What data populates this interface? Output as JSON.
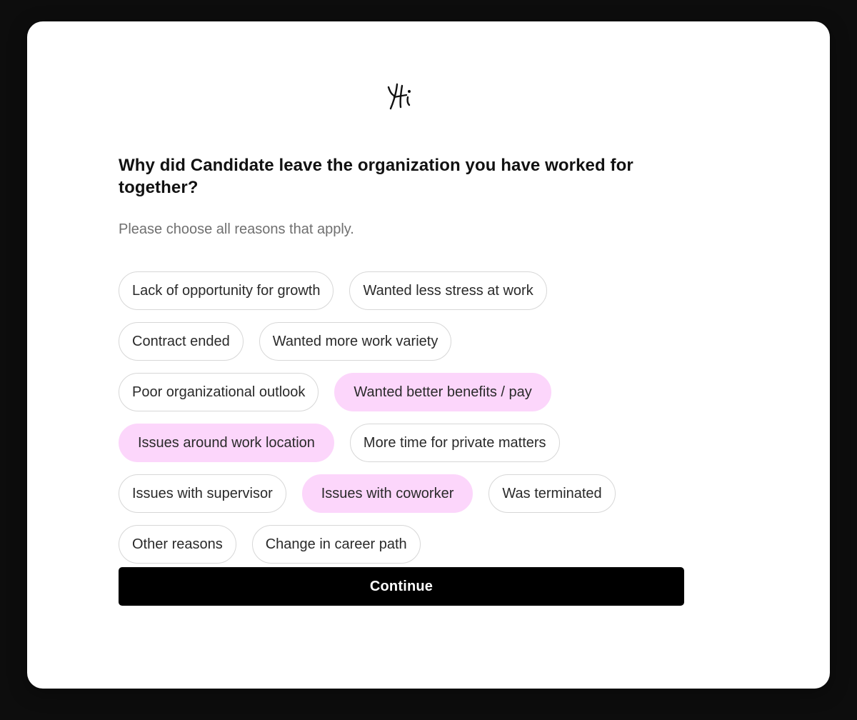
{
  "logo": {
    "icon": "yi-signature-logo"
  },
  "question": "Why did Candidate leave the organization you have worked for together?",
  "hint": "Please choose all reasons that apply.",
  "options": [
    {
      "label": "Lack of opportunity for growth",
      "selected": false
    },
    {
      "label": "Wanted less stress at work",
      "selected": false
    },
    {
      "label": "Contract ended",
      "selected": false
    },
    {
      "label": "Wanted more work variety",
      "selected": false
    },
    {
      "label": "Poor organizational outlook",
      "selected": false
    },
    {
      "label": "Wanted better benefits / pay",
      "selected": true
    },
    {
      "label": "Issues around work location",
      "selected": true
    },
    {
      "label": "More time for private matters",
      "selected": false
    },
    {
      "label": "Issues with supervisor",
      "selected": false
    },
    {
      "label": "Issues with coworker",
      "selected": true
    },
    {
      "label": "Was terminated",
      "selected": false
    },
    {
      "label": "Other reasons",
      "selected": false
    },
    {
      "label": "Change in career path",
      "selected": false
    }
  ],
  "continue_label": "Continue",
  "colors": {
    "selected_pill": "#fcd6fb",
    "pill_border": "#d7d7d7",
    "button": "#000000"
  }
}
